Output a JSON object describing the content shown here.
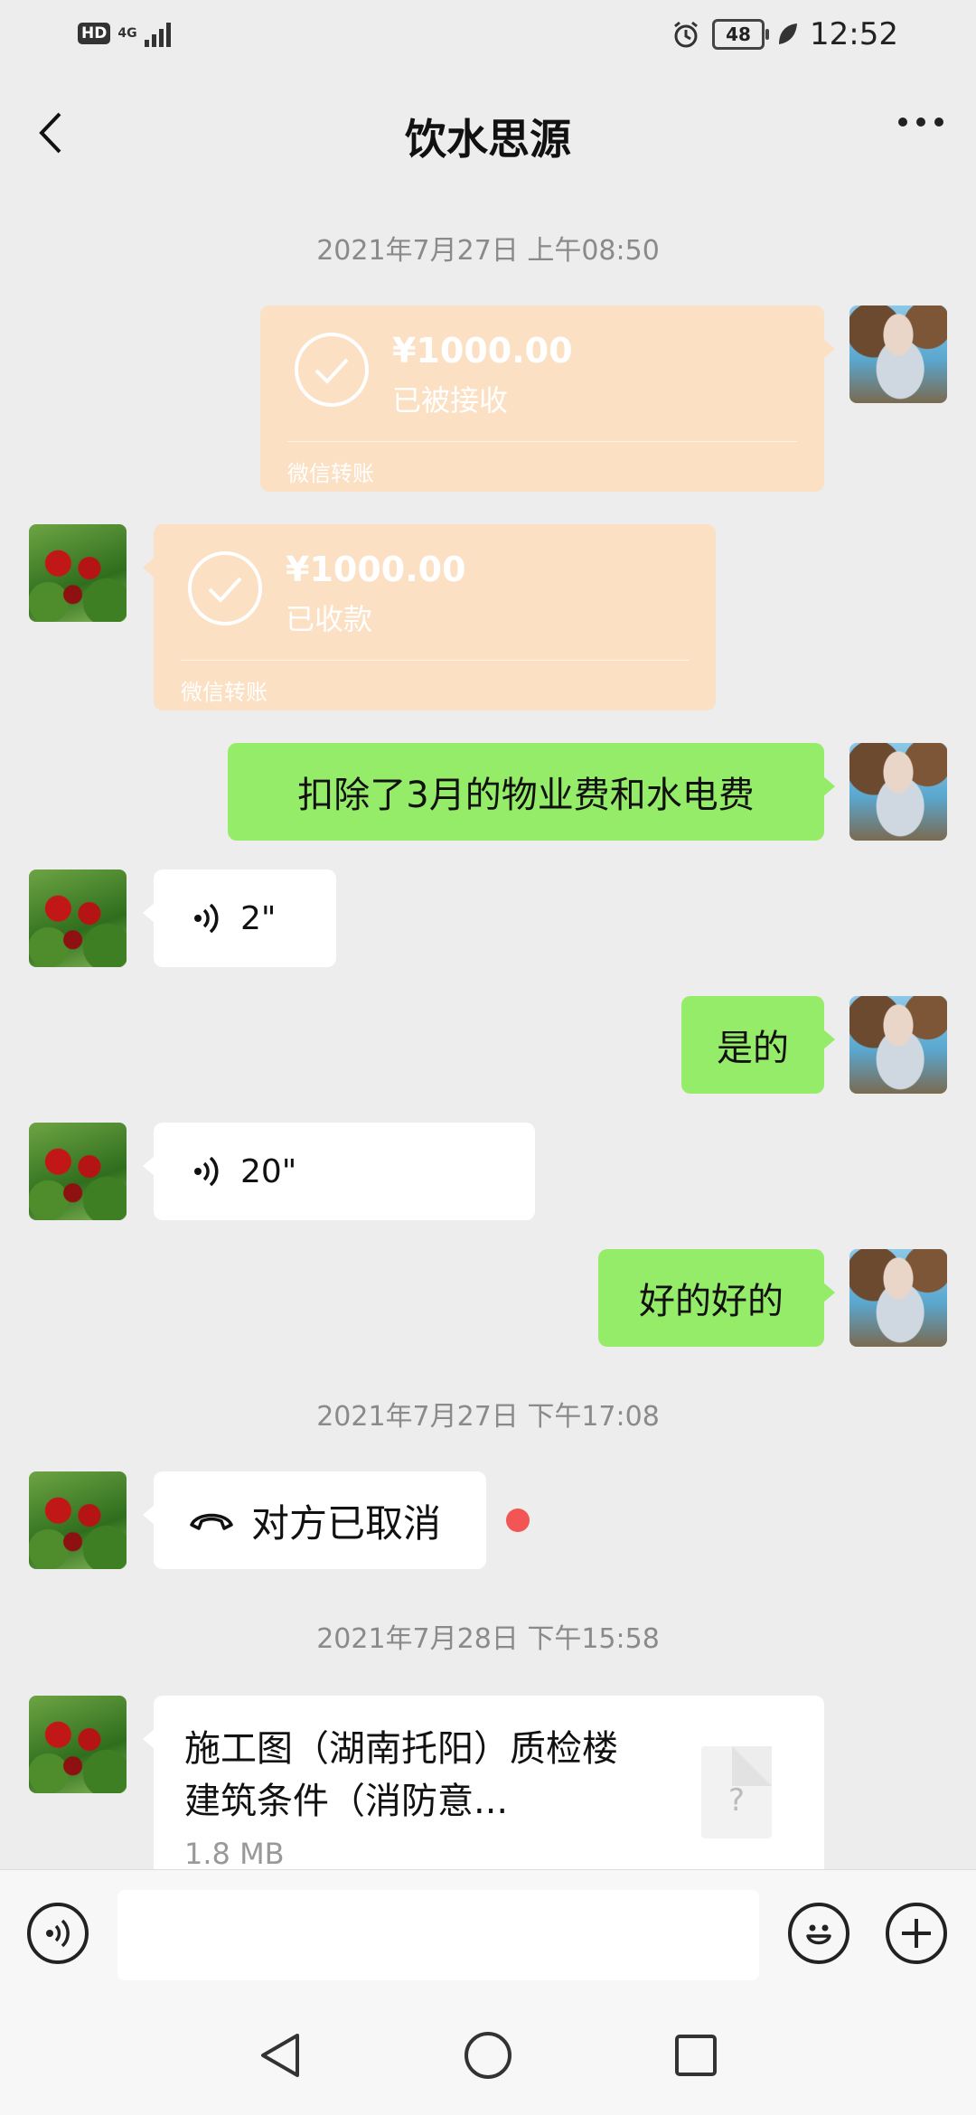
{
  "status_bar": {
    "hd": "HD",
    "network": "4G",
    "battery": "48",
    "time": "12:52"
  },
  "header": {
    "title": "饮水思源"
  },
  "messages": {
    "ts1": "2021年7月27日 上午08:50",
    "transfer_sent": {
      "amount": "¥1000.00",
      "status": "已被接收",
      "footer": "微信转账"
    },
    "transfer_received": {
      "amount": "¥1000.00",
      "status": "已收款",
      "footer": "微信转账"
    },
    "text1": "扣除了3月的物业费和水电费",
    "voice1": "2\"",
    "text2": "是的",
    "voice2": "20\"",
    "text3": "好的好的",
    "ts2": "2021年7月27日 下午17:08",
    "call": "对方已取消",
    "ts3": "2021年7月28日 下午15:58",
    "file": {
      "name": "施工图（湖南托阳）质检楼 建筑条件（消防意...",
      "size": "1.8 MB",
      "icon_text": "?"
    }
  },
  "icons": {
    "back": "chevron-left-icon",
    "more": "more-icon",
    "voice_input": "voice-icon",
    "emoji": "emoji-icon",
    "plus": "plus-icon"
  },
  "colors": {
    "green_bubble": "#95ec69",
    "transfer_bubble": "#fce0c3",
    "unread_dot": "#f25553",
    "background": "#ededed"
  }
}
